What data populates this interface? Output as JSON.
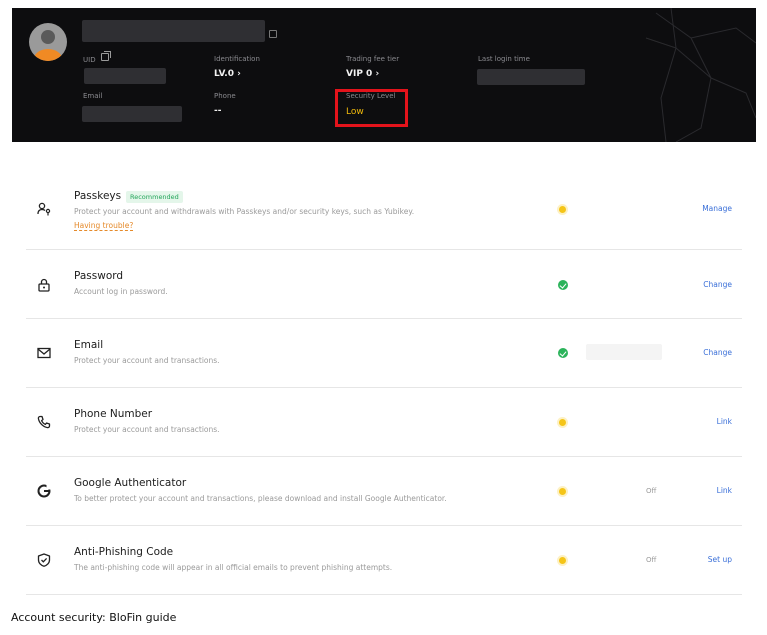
{
  "header": {
    "uid_label": "UID",
    "identification_label": "Identification",
    "identification_value": "LV.0 ›",
    "trading_fee_label": "Trading fee tier",
    "trading_fee_value": "VIP 0 ›",
    "last_login_label": "Last login time",
    "email_label": "Email",
    "phone_label": "Phone",
    "phone_value": "--",
    "security_level_label": "Security Level",
    "security_level_value": "Low"
  },
  "colors": {
    "accent_blue": "#3a6fd8",
    "warning_yellow": "#f5c518",
    "success_green": "#2bb35a",
    "highlight_red": "#e3131b",
    "security_low": "#f0b90b"
  },
  "rows": [
    {
      "icon": "passkey-icon",
      "title": "Passkeys",
      "badge": "Recommended",
      "desc": "Protect your account and withdrawals with Passkeys and/or security keys, such as Yubikey.",
      "link": "Having trouble?",
      "status": "warning",
      "action": "Manage"
    },
    {
      "icon": "lock-icon",
      "title": "Password",
      "desc": "Account log in password.",
      "status": "ok",
      "action": "Change"
    },
    {
      "icon": "mail-icon",
      "title": "Email",
      "desc": "Protect your account and transactions.",
      "status": "ok",
      "action": "Change"
    },
    {
      "icon": "phone-icon",
      "title": "Phone Number",
      "desc": "Protect your account and transactions.",
      "status": "warning",
      "action": "Link"
    },
    {
      "icon": "google-authenticator-icon",
      "title": "Google Authenticator",
      "desc": "To better protect your account and transactions, please download and install Google Authenticator.",
      "status": "warning",
      "state": "Off",
      "action": "Link"
    },
    {
      "icon": "shield-check-icon",
      "title": "Anti-Phishing Code",
      "desc": "The anti-phishing code will appear in all official emails to prevent phishing attempts.",
      "status": "warning",
      "state": "Off",
      "action": "Set up"
    }
  ],
  "caption": "Account security: BloFin guide"
}
